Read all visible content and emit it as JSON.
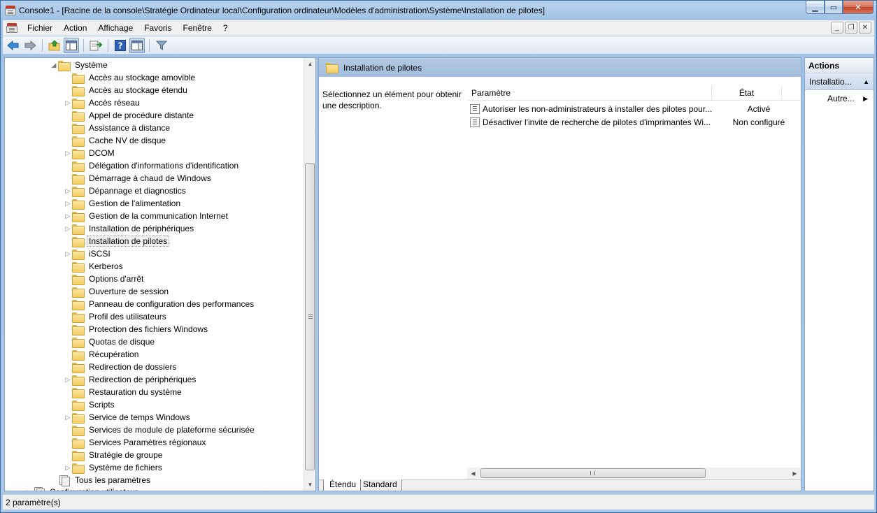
{
  "window": {
    "title": "Console1 - [Racine de la console\\Stratégie Ordinateur local\\Configuration ordinateur\\Modèles d'administration\\Système\\Installation de pilotes]"
  },
  "menu": [
    "Fichier",
    "Action",
    "Affichage",
    "Favoris",
    "Fenêtre",
    "?"
  ],
  "tree": {
    "root": "Système",
    "items": [
      {
        "label": "Accès au stockage amovible",
        "expandable": false
      },
      {
        "label": "Accès au stockage étendu",
        "expandable": false
      },
      {
        "label": "Accès réseau",
        "expandable": true
      },
      {
        "label": "Appel de procédure distante",
        "expandable": false
      },
      {
        "label": "Assistance à distance",
        "expandable": false
      },
      {
        "label": "Cache NV de disque",
        "expandable": false
      },
      {
        "label": "DCOM",
        "expandable": true
      },
      {
        "label": "Délégation d'informations d'identification",
        "expandable": false
      },
      {
        "label": "Démarrage à chaud de Windows",
        "expandable": false
      },
      {
        "label": "Dépannage et diagnostics",
        "expandable": true
      },
      {
        "label": "Gestion de l'alimentation",
        "expandable": true
      },
      {
        "label": "Gestion de la communication Internet",
        "expandable": true
      },
      {
        "label": "Installation de périphériques",
        "expandable": true
      },
      {
        "label": "Installation de pilotes",
        "expandable": false,
        "selected": true
      },
      {
        "label": "iSCSI",
        "expandable": true
      },
      {
        "label": "Kerberos",
        "expandable": false
      },
      {
        "label": "Options d'arrêt",
        "expandable": false
      },
      {
        "label": "Ouverture de session",
        "expandable": false
      },
      {
        "label": "Panneau de configuration des performances",
        "expandable": false
      },
      {
        "label": "Profil des utilisateurs",
        "expandable": false
      },
      {
        "label": "Protection des fichiers Windows",
        "expandable": false
      },
      {
        "label": "Quotas de disque",
        "expandable": false
      },
      {
        "label": "Récupération",
        "expandable": false
      },
      {
        "label": "Redirection de dossiers",
        "expandable": false
      },
      {
        "label": "Redirection de périphériques",
        "expandable": true
      },
      {
        "label": "Restauration du système",
        "expandable": false
      },
      {
        "label": "Scripts",
        "expandable": false
      },
      {
        "label": "Service de temps Windows",
        "expandable": true
      },
      {
        "label": "Services de module de plateforme sécurisée",
        "expandable": false
      },
      {
        "label": "Services Paramètres régionaux",
        "expandable": false
      },
      {
        "label": "Stratégie de groupe",
        "expandable": false
      },
      {
        "label": "Système de fichiers",
        "expandable": true
      }
    ],
    "all_settings": "Tous les paramètres",
    "partial_next": "Configuration utilisateur"
  },
  "center": {
    "header_title": "Installation de pilotes",
    "description": "Sélectionnez un élément pour obtenir une description.",
    "columns": {
      "setting": "Paramètre",
      "state": "État"
    },
    "rows": [
      {
        "name": "Autoriser les non-administrateurs à installer des pilotes pour...",
        "state": "Activé"
      },
      {
        "name": "Désactiver l'invite de recherche de pilotes d'imprimantes Wi...",
        "state": "Non configuré"
      }
    ],
    "tabs": [
      "Étendu",
      "Standard"
    ]
  },
  "actions": {
    "header": "Actions",
    "section": "Installatio...",
    "item": "Autre..."
  },
  "status": "2 paramètre(s)"
}
